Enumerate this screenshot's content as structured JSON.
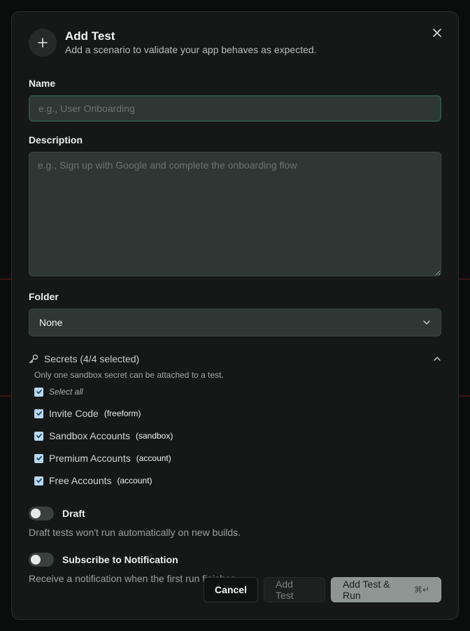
{
  "modal": {
    "title": "Add Test",
    "subtitle": "Add a scenario to validate your app behaves as expected.",
    "close_icon": "close-icon"
  },
  "name": {
    "label": "Name",
    "value": "",
    "placeholder": "e.g., User Onboarding"
  },
  "description": {
    "label": "Description",
    "value": "",
    "placeholder": "e.g., Sign up with Google and complete the onboarding flow"
  },
  "folder": {
    "label": "Folder",
    "selected": "None"
  },
  "secrets": {
    "title": "Secrets (4/4 selected)",
    "note": "Only one sandbox secret can be attached to a test.",
    "select_all": "Select all",
    "items": [
      {
        "name": "Invite Code",
        "type": "(freeform)",
        "checked": true
      },
      {
        "name": "Sandbox Accounts",
        "type": "(sandbox)",
        "checked": true
      },
      {
        "name": "Premium Accounts",
        "type": "(account)",
        "checked": true
      },
      {
        "name": "Free Accounts",
        "type": "(account)",
        "checked": true
      }
    ]
  },
  "draft": {
    "label": "Draft",
    "description": "Draft tests won't run automatically on new builds.",
    "enabled": false
  },
  "notification": {
    "label": "Subscribe to Notification",
    "description": "Receive a notification when the first run finishes.",
    "enabled": false
  },
  "footer": {
    "cancel_label": "Cancel",
    "add_label": "Add Test",
    "run_label": "Add Test & Run",
    "run_shortcut": "⌘↵"
  },
  "colors": {
    "accent_border": "#2d5142",
    "checkbox": "#b8d7f0",
    "primary_button": "#8e9592"
  }
}
